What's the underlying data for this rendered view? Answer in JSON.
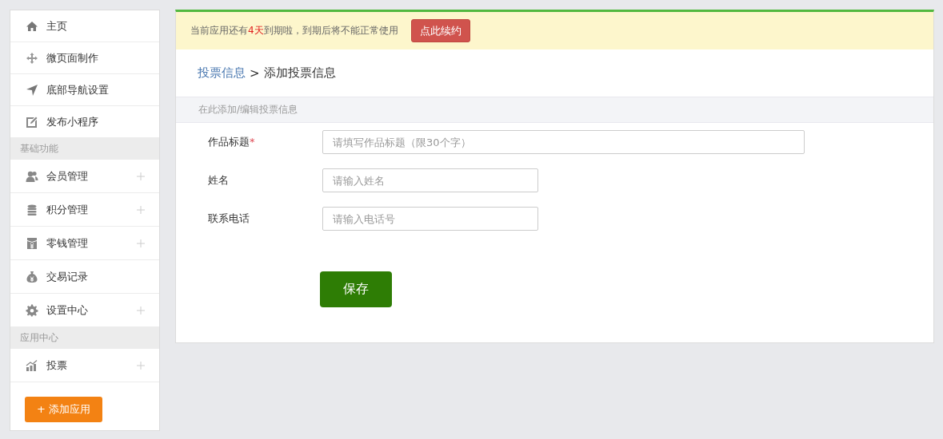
{
  "sidebar": {
    "groups": [
      {
        "items": [
          {
            "label": "主页",
            "kind": "home",
            "expandable": false
          },
          {
            "label": "微页面制作",
            "kind": "move",
            "expandable": false
          },
          {
            "label": "底部导航设置",
            "kind": "navigate",
            "expandable": false
          },
          {
            "label": "发布小程序",
            "kind": "edit",
            "expandable": false
          }
        ]
      },
      {
        "title": "基础功能",
        "items": [
          {
            "label": "会员管理",
            "kind": "users",
            "expandable": true
          },
          {
            "label": "积分管理",
            "kind": "database",
            "expandable": true
          },
          {
            "label": "零钱管理",
            "kind": "wallet",
            "expandable": true
          },
          {
            "label": "交易记录",
            "kind": "moneybag",
            "expandable": false
          },
          {
            "label": "设置中心",
            "kind": "gear",
            "expandable": true
          }
        ]
      },
      {
        "title": "应用中心",
        "items": [
          {
            "label": "投票",
            "kind": "chart",
            "expandable": true
          }
        ]
      }
    ],
    "add_button": "+ 添加应用"
  },
  "notice": {
    "before": "当前应用还有",
    "highlight": "4天",
    "after": "到期啦，到期后将不能正常使用",
    "button": "点此续约"
  },
  "breadcrumb": {
    "parent": "投票信息",
    "separator": ">",
    "current": "添加投票信息"
  },
  "section_title": "在此添加/编辑投票信息",
  "fields": [
    {
      "label": "作品标题",
      "required_mark": "*",
      "placeholder": "请填写作品标题（限30个字）",
      "wide": true
    },
    {
      "label": "姓名",
      "placeholder": "请输入姓名",
      "wide": false
    },
    {
      "label": "联系电话",
      "placeholder": "请输入电话号",
      "wide": false
    }
  ],
  "save_button": "保存"
}
